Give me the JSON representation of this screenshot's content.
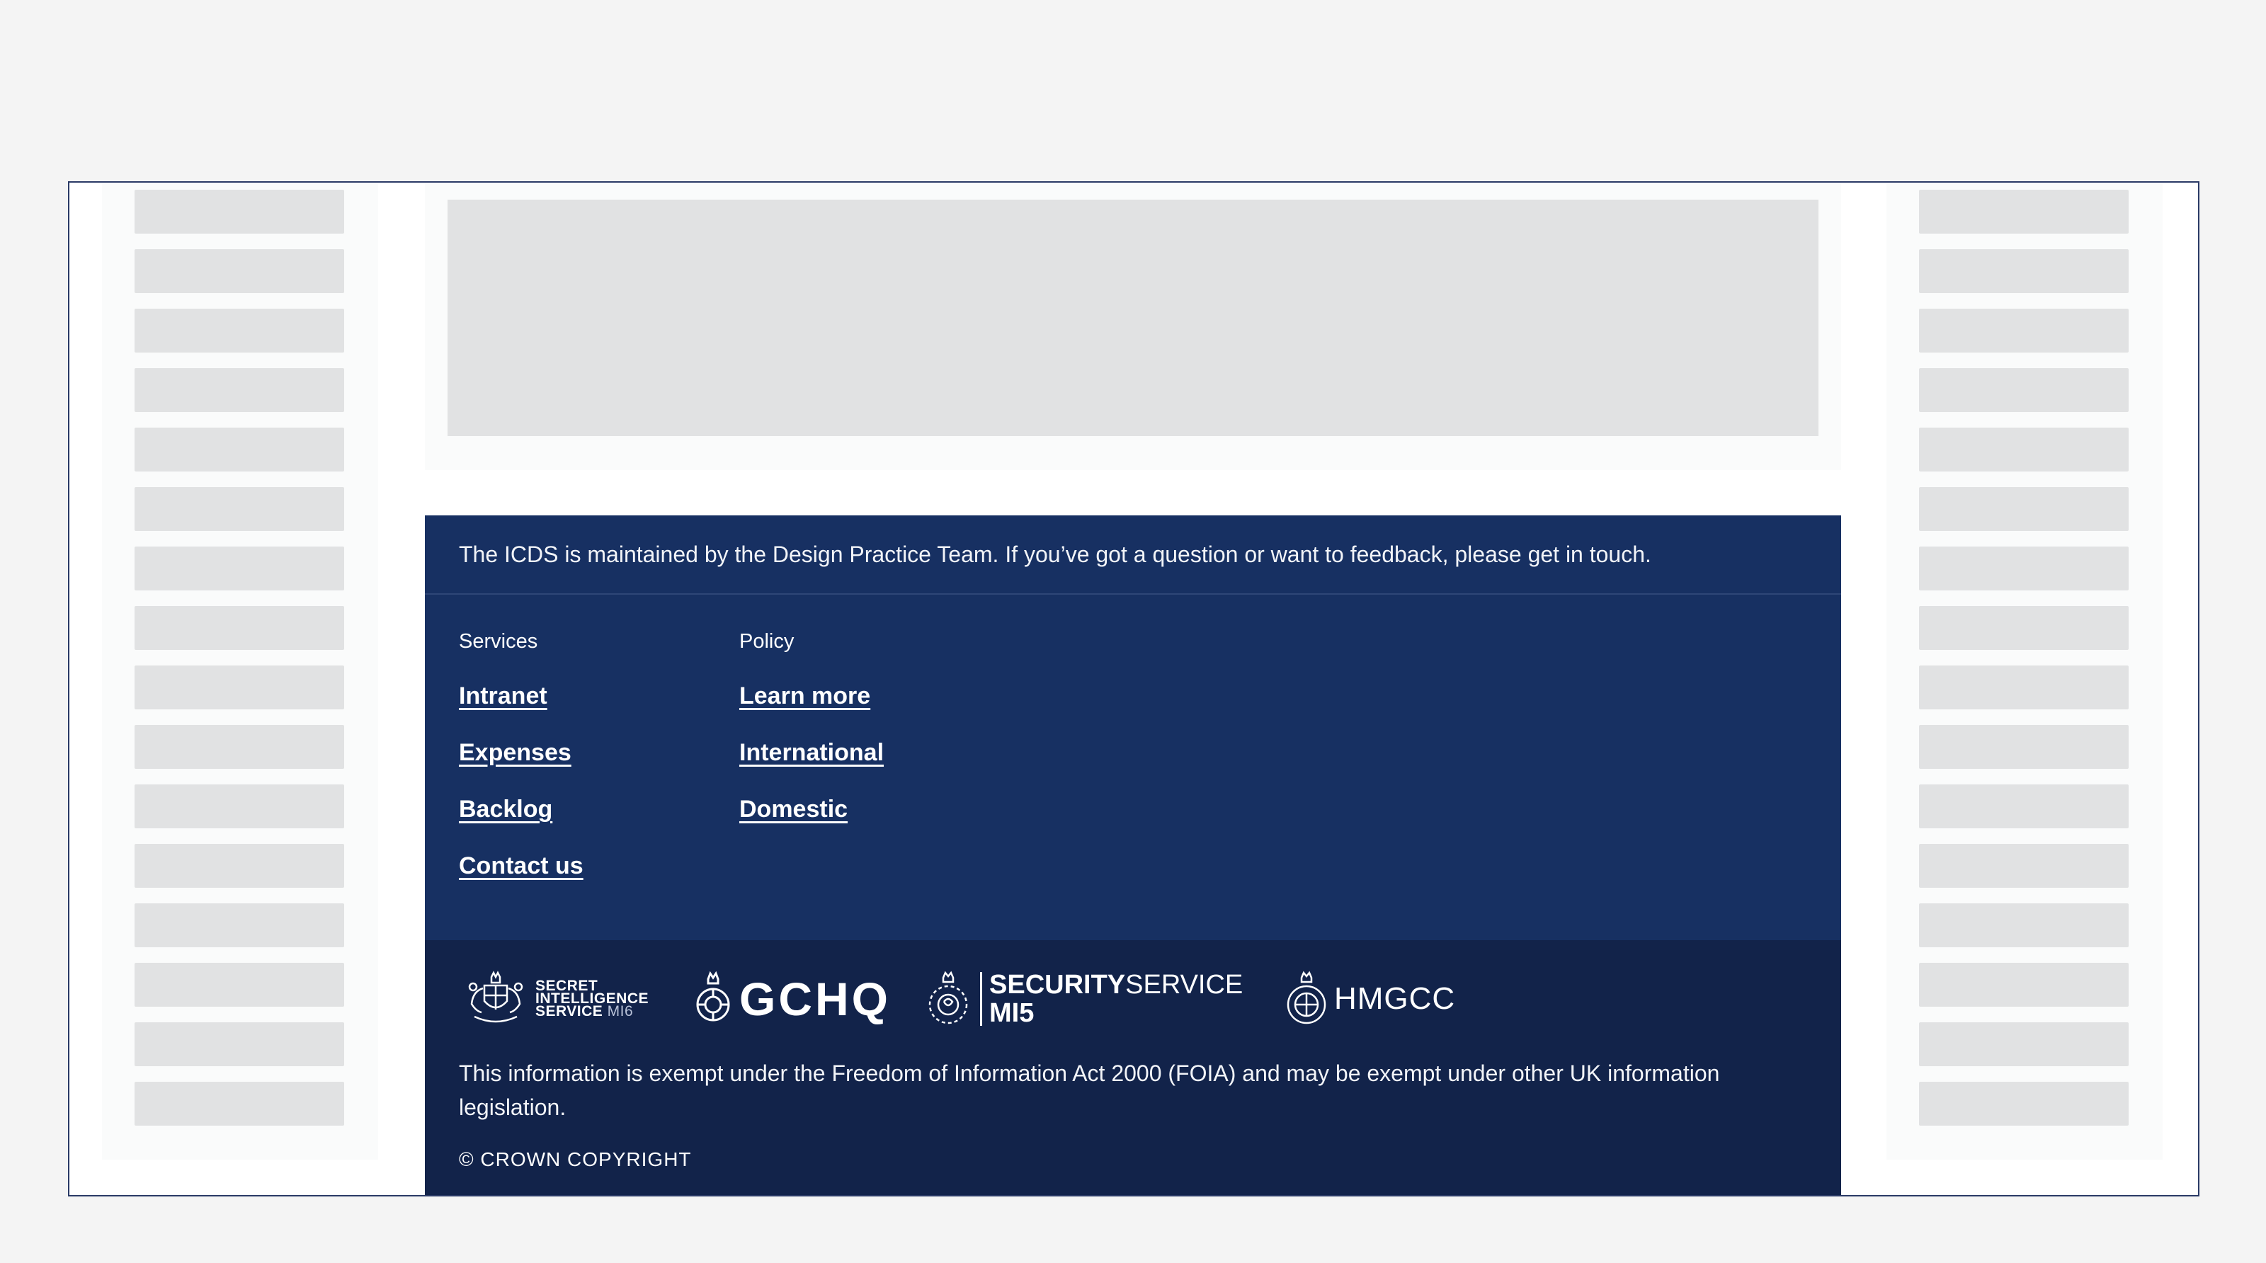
{
  "footer": {
    "message": "The ICDS is maintained by the Design Practice Team. If you’ve got a question or want to feedback, please get in touch.",
    "columns": [
      {
        "heading": "Services",
        "links": [
          "Intranet",
          "Expenses",
          "Backlog",
          "Contact us"
        ]
      },
      {
        "heading": "Policy",
        "links": [
          "Learn more",
          "International",
          "Domestic"
        ]
      }
    ],
    "logos": {
      "sis": {
        "line1": "SECRET",
        "line2": "INTELLIGENCE",
        "line3": "SERVICE",
        "suffix": "MI6",
        "icon": "royal-crest-icon"
      },
      "gchq": {
        "text": "GCHQ",
        "icon": "gchq-crest-icon"
      },
      "mi5": {
        "bold": "SECURITY",
        "regular": "SERVICE",
        "line2": "MI5",
        "icon": "mi5-crest-icon"
      },
      "hmgcc": {
        "text": "HMGCC",
        "icon": "hmgcc-crest-icon"
      }
    },
    "legal": "This information is exempt under the Freedom of Information Act 2000 (FOIA) and may be exempt under other UK information legislation.",
    "copyright": "© CROWN COPYRIGHT"
  },
  "colors": {
    "page_bg": "#f4f4f4",
    "footer_primary": "#173062",
    "footer_secondary": "#12234a",
    "skeleton": "#e1e2e3"
  }
}
